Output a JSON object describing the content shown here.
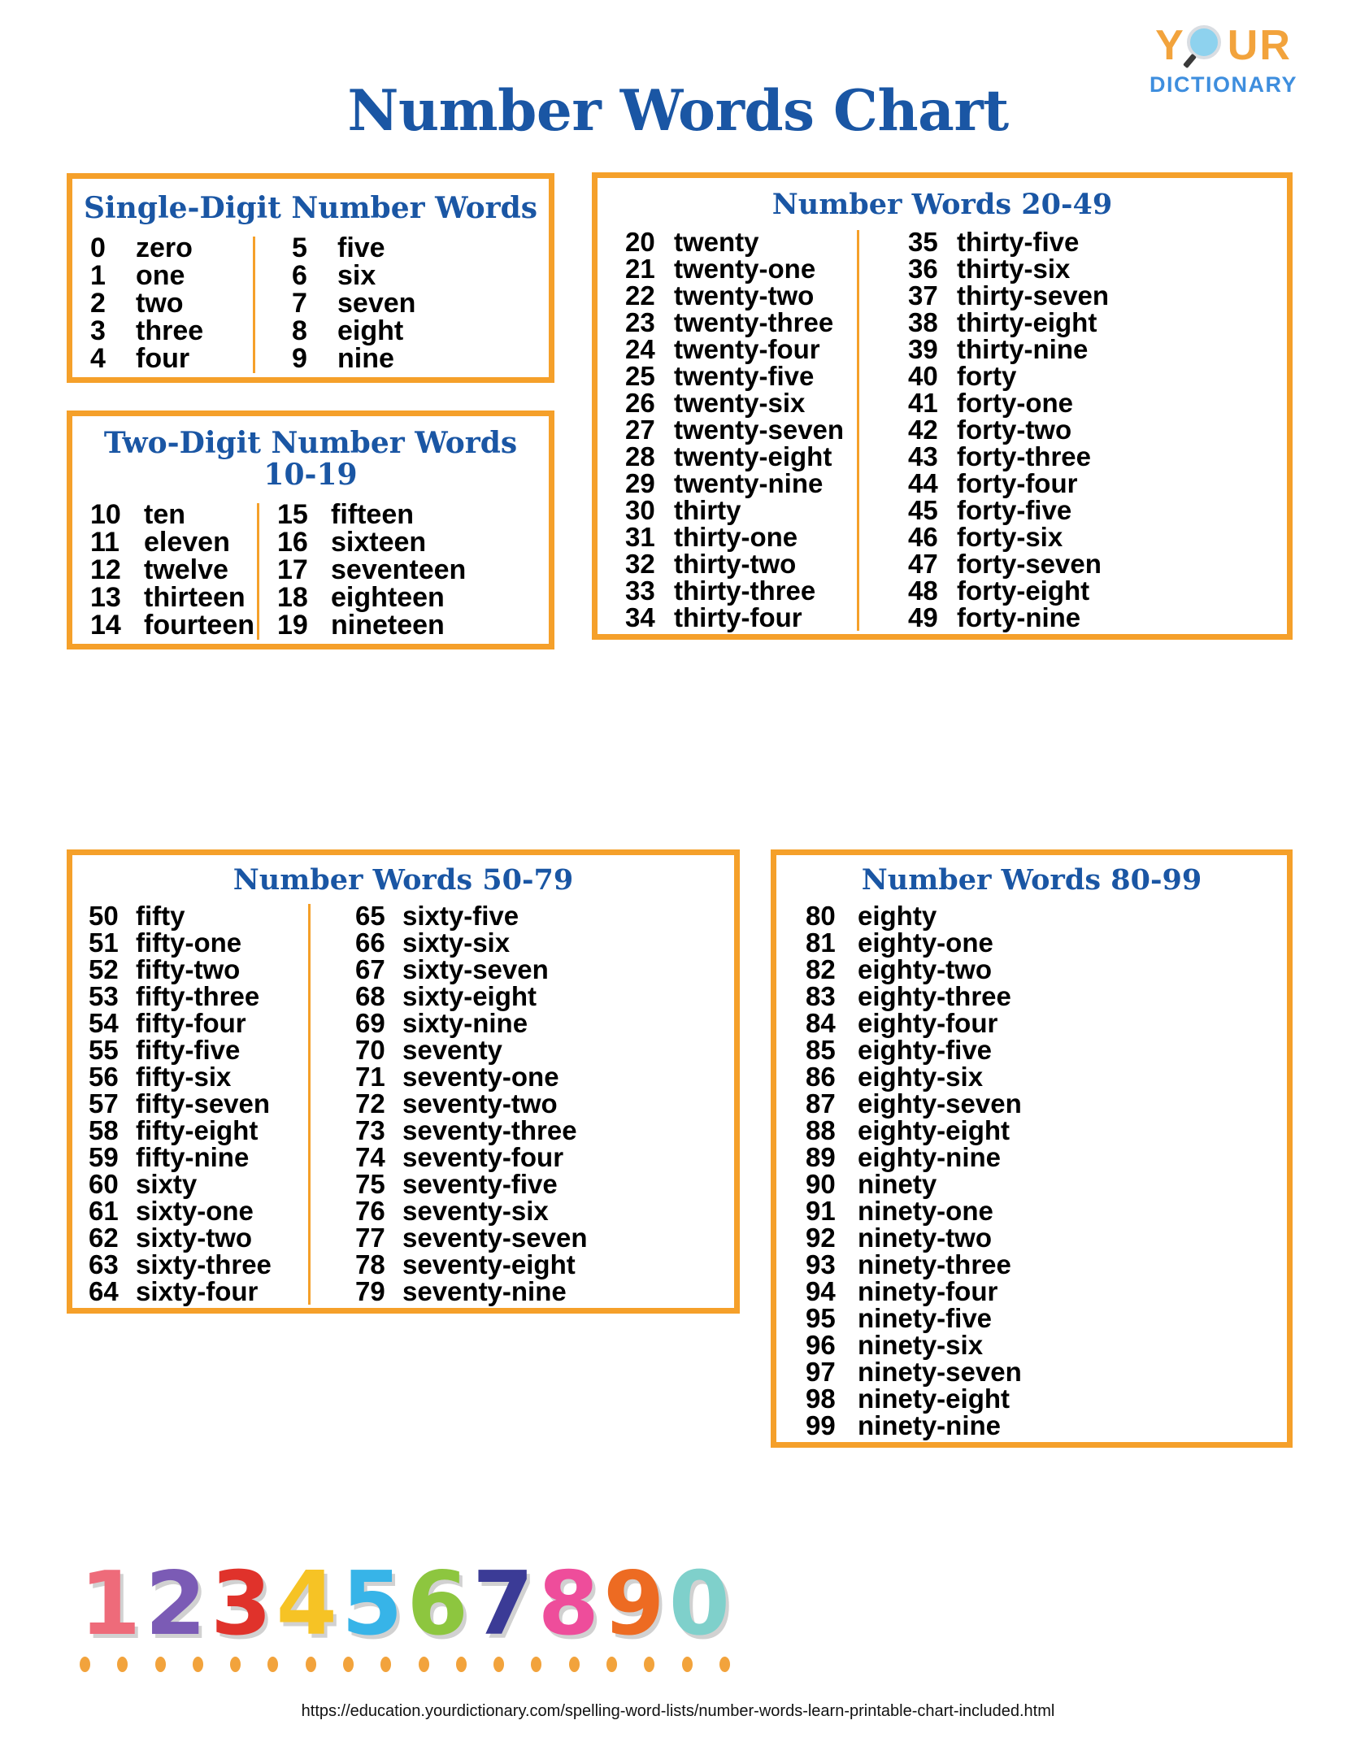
{
  "logo": {
    "word_top": "YOUR",
    "word_top_pre": "Y",
    "word_top_post": "UR",
    "word_bottom": "DICTIONARY",
    "magnifier_icon": "magnifying-glass-icon",
    "orange": "#F2A33C",
    "blue": "#3E8EDE"
  },
  "title": "Number Words Chart",
  "colors": {
    "border_orange": "#F5A02A",
    "heading_blue": "#1A56A4",
    "text_black": "#000000"
  },
  "boxes": {
    "single": {
      "title": "Single-Digit Number Words",
      "left": [
        {
          "num": "0",
          "word": "zero"
        },
        {
          "num": "1",
          "word": "one"
        },
        {
          "num": "2",
          "word": "two"
        },
        {
          "num": "3",
          "word": "three"
        },
        {
          "num": "4",
          "word": "four"
        }
      ],
      "right": [
        {
          "num": "5",
          "word": "five"
        },
        {
          "num": "6",
          "word": "six"
        },
        {
          "num": "7",
          "word": "seven"
        },
        {
          "num": "8",
          "word": "eight"
        },
        {
          "num": "9",
          "word": "nine"
        }
      ]
    },
    "teen": {
      "title_line1": "Two-Digit Number Words",
      "title_line2": "10-19",
      "left": [
        {
          "num": "10",
          "word": "ten"
        },
        {
          "num": "11",
          "word": "eleven"
        },
        {
          "num": "12",
          "word": "twelve"
        },
        {
          "num": "13",
          "word": "thirteen"
        },
        {
          "num": "14",
          "word": "fourteen"
        }
      ],
      "right": [
        {
          "num": "15",
          "word": "fifteen"
        },
        {
          "num": "16",
          "word": "sixteen"
        },
        {
          "num": "17",
          "word": "seventeen"
        },
        {
          "num": "18",
          "word": "eighteen"
        },
        {
          "num": "19",
          "word": "nineteen"
        }
      ]
    },
    "twenty_forty_nine": {
      "title": "Number Words 20-49",
      "left": [
        {
          "num": "20",
          "word": "twenty"
        },
        {
          "num": "21",
          "word": "twenty-one"
        },
        {
          "num": "22",
          "word": "twenty-two"
        },
        {
          "num": "23",
          "word": "twenty-three"
        },
        {
          "num": "24",
          "word": "twenty-four"
        },
        {
          "num": "25",
          "word": "twenty-five"
        },
        {
          "num": "26",
          "word": "twenty-six"
        },
        {
          "num": "27",
          "word": "twenty-seven"
        },
        {
          "num": "28",
          "word": "twenty-eight"
        },
        {
          "num": "29",
          "word": "twenty-nine"
        },
        {
          "num": "30",
          "word": "thirty"
        },
        {
          "num": "31",
          "word": "thirty-one"
        },
        {
          "num": "32",
          "word": "thirty-two"
        },
        {
          "num": "33",
          "word": "thirty-three"
        },
        {
          "num": "34",
          "word": "thirty-four"
        }
      ],
      "right": [
        {
          "num": "35",
          "word": "thirty-five"
        },
        {
          "num": "36",
          "word": "thirty-six"
        },
        {
          "num": "37",
          "word": "thirty-seven"
        },
        {
          "num": "38",
          "word": "thirty-eight"
        },
        {
          "num": "39",
          "word": "thirty-nine"
        },
        {
          "num": "40",
          "word": "forty"
        },
        {
          "num": "41",
          "word": "forty-one"
        },
        {
          "num": "42",
          "word": "forty-two"
        },
        {
          "num": "43",
          "word": "forty-three"
        },
        {
          "num": "44",
          "word": "forty-four"
        },
        {
          "num": "45",
          "word": "forty-five"
        },
        {
          "num": "46",
          "word": "forty-six"
        },
        {
          "num": "47",
          "word": "forty-seven"
        },
        {
          "num": "48",
          "word": "forty-eight"
        },
        {
          "num": "49",
          "word": "forty-nine"
        }
      ]
    },
    "fifty_seventy_nine": {
      "title": "Number Words 50-79",
      "left": [
        {
          "num": "50",
          "word": "fifty"
        },
        {
          "num": "51",
          "word": "fifty-one"
        },
        {
          "num": "52",
          "word": "fifty-two"
        },
        {
          "num": "53",
          "word": "fifty-three"
        },
        {
          "num": "54",
          "word": "fifty-four"
        },
        {
          "num": "55",
          "word": "fifty-five"
        },
        {
          "num": "56",
          "word": "fifty-six"
        },
        {
          "num": "57",
          "word": "fifty-seven"
        },
        {
          "num": "58",
          "word": "fifty-eight"
        },
        {
          "num": "59",
          "word": "fifty-nine"
        },
        {
          "num": "60",
          "word": "sixty"
        },
        {
          "num": "61",
          "word": "sixty-one"
        },
        {
          "num": "62",
          "word": "sixty-two"
        },
        {
          "num": "63",
          "word": "sixty-three"
        },
        {
          "num": "64",
          "word": "sixty-four"
        }
      ],
      "right": [
        {
          "num": "65",
          "word": "sixty-five"
        },
        {
          "num": "66",
          "word": "sixty-six"
        },
        {
          "num": "67",
          "word": "sixty-seven"
        },
        {
          "num": "68",
          "word": "sixty-eight"
        },
        {
          "num": "69",
          "word": "sixty-nine"
        },
        {
          "num": "70",
          "word": "seventy"
        },
        {
          "num": "71",
          "word": "seventy-one"
        },
        {
          "num": "72",
          "word": "seventy-two"
        },
        {
          "num": "73",
          "word": "seventy-three"
        },
        {
          "num": "74",
          "word": "seventy-four"
        },
        {
          "num": "75",
          "word": "seventy-five"
        },
        {
          "num": "76",
          "word": "seventy-six"
        },
        {
          "num": "77",
          "word": "seventy-seven"
        },
        {
          "num": "78",
          "word": "seventy-eight"
        },
        {
          "num": "79",
          "word": "seventy-nine"
        }
      ]
    },
    "eighty_ninety_nine": {
      "title": "Number Words 80-99",
      "left": [
        {
          "num": "80",
          "word": "eighty"
        },
        {
          "num": "81",
          "word": "eighty-one"
        },
        {
          "num": "82",
          "word": "eighty-two"
        },
        {
          "num": "83",
          "word": "eighty-three"
        },
        {
          "num": "84",
          "word": "eighty-four"
        },
        {
          "num": "85",
          "word": "eighty-five"
        },
        {
          "num": "86",
          "word": "eighty-six"
        },
        {
          "num": "87",
          "word": "eighty-seven"
        },
        {
          "num": "88",
          "word": "eighty-eight"
        },
        {
          "num": "89",
          "word": "eighty-nine"
        },
        {
          "num": "90",
          "word": "ninety"
        },
        {
          "num": "91",
          "word": "ninety-one"
        },
        {
          "num": "92",
          "word": "ninety-two"
        },
        {
          "num": "93",
          "word": "ninety-three"
        },
        {
          "num": "94",
          "word": "ninety-four"
        },
        {
          "num": "95",
          "word": "ninety-five"
        },
        {
          "num": "96",
          "word": "ninety-six"
        },
        {
          "num": "97",
          "word": "ninety-seven"
        },
        {
          "num": "98",
          "word": "ninety-eight"
        },
        {
          "num": "99",
          "word": "ninety-nine"
        }
      ]
    }
  },
  "decorative_numbers": [
    {
      "glyph": "1",
      "color": "#EE6B7A"
    },
    {
      "glyph": "2",
      "color": "#7B5BB5"
    },
    {
      "glyph": "3",
      "color": "#E0322B"
    },
    {
      "glyph": "4",
      "color": "#F6C325"
    },
    {
      "glyph": "5",
      "color": "#37B4E8"
    },
    {
      "glyph": "6",
      "color": "#8DC63F"
    },
    {
      "glyph": "7",
      "color": "#3B3B96"
    },
    {
      "glyph": "8",
      "color": "#EE4D9B"
    },
    {
      "glyph": "9",
      "color": "#ED6B22"
    },
    {
      "glyph": "0",
      "color": "#7FD0CB"
    }
  ],
  "dot_row": {
    "count": 18,
    "color": "#F2A33C"
  },
  "footer": {
    "url": "https://education.yourdictionary.com/spelling-word-lists/number-words-learn-printable-chart-included.html"
  }
}
